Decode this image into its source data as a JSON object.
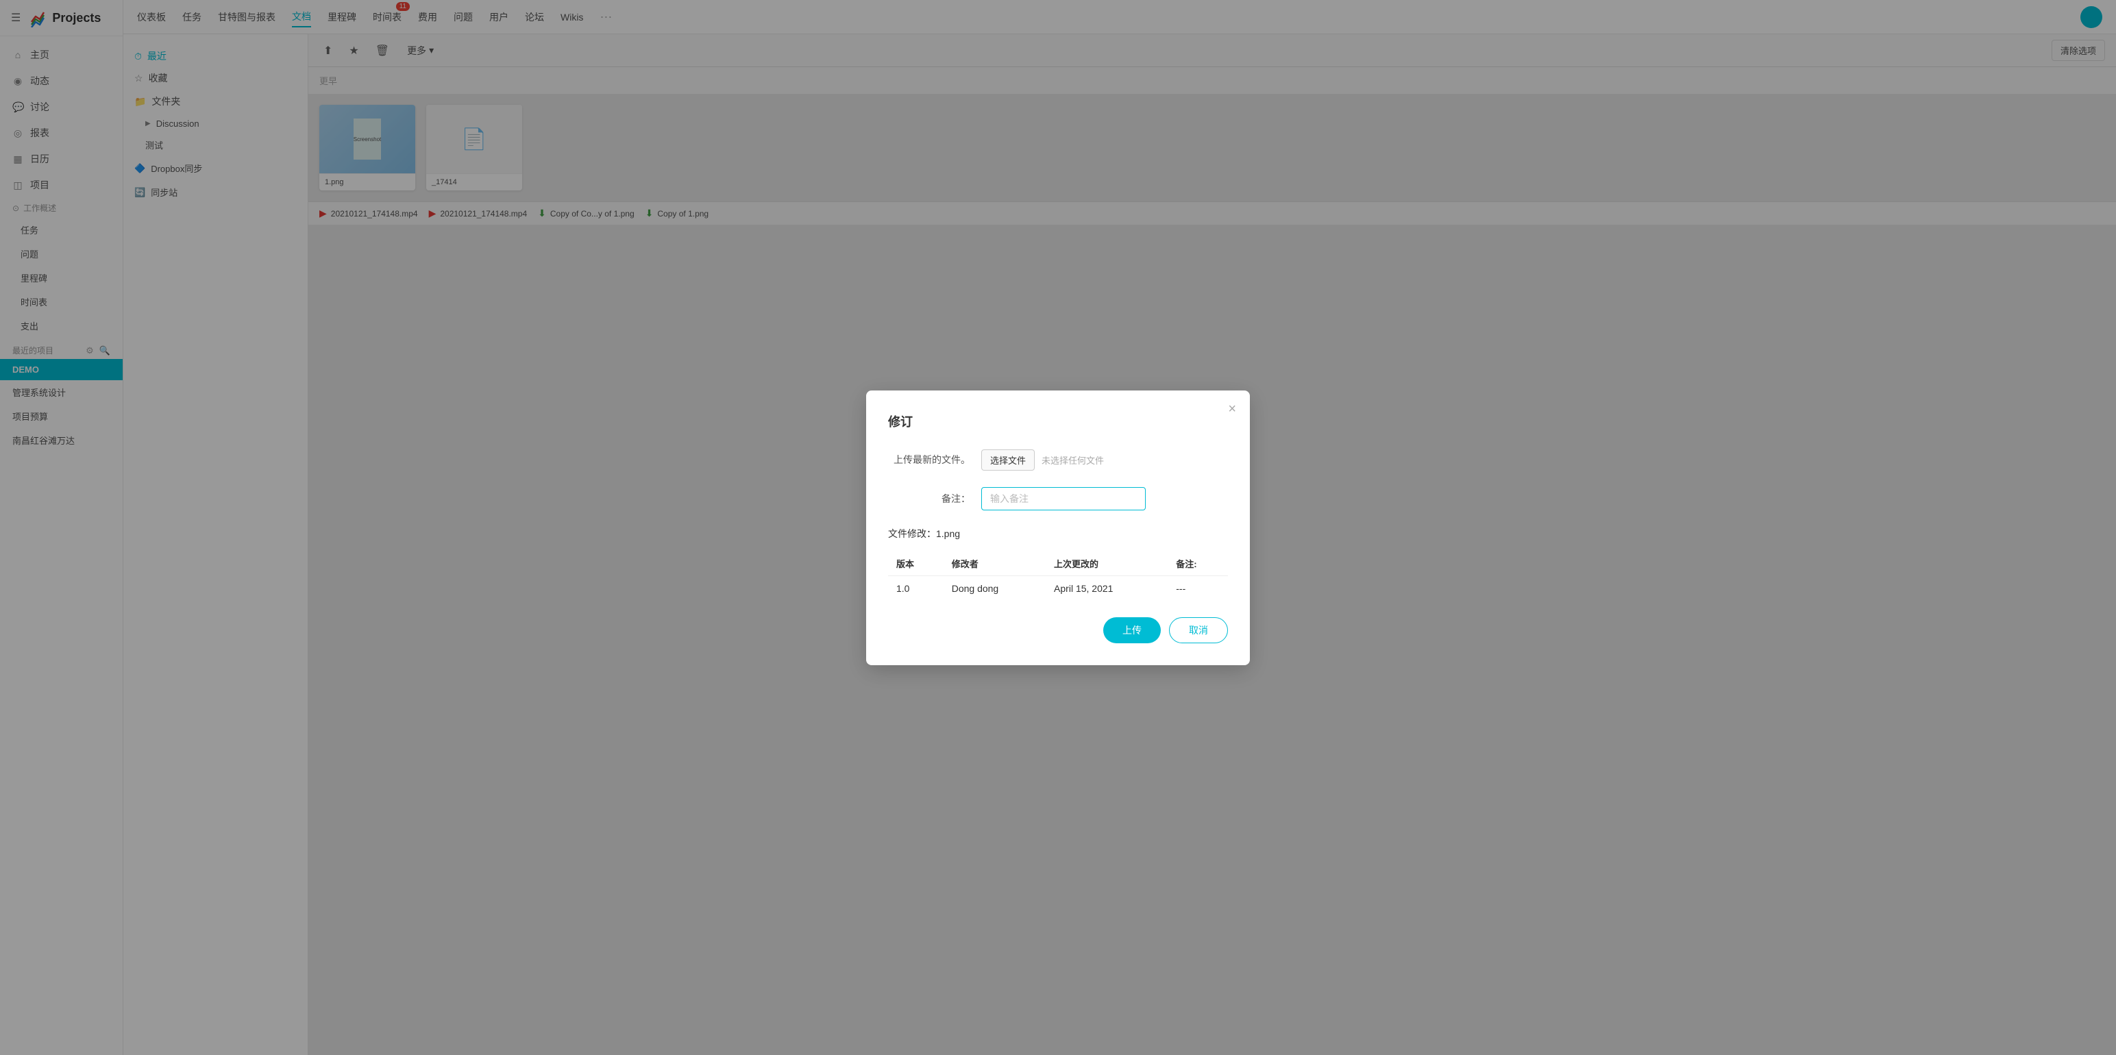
{
  "app": {
    "title": "Projects",
    "hamburger": "☰"
  },
  "top_nav": {
    "items": [
      {
        "label": "仪表板",
        "active": false
      },
      {
        "label": "任务",
        "active": false
      },
      {
        "label": "甘特图与报表",
        "active": false
      },
      {
        "label": "文档",
        "active": true
      },
      {
        "label": "里程碑",
        "active": false
      },
      {
        "label": "时间表",
        "active": false,
        "badge": "11"
      },
      {
        "label": "费用",
        "active": false
      },
      {
        "label": "问题",
        "active": false
      },
      {
        "label": "用户",
        "active": false
      },
      {
        "label": "论坛",
        "active": false
      },
      {
        "label": "Wikis",
        "active": false
      }
    ],
    "more": "···"
  },
  "sidebar": {
    "nav_items": [
      {
        "icon": "⌂",
        "label": "主页"
      },
      {
        "icon": "◉",
        "label": "动态"
      },
      {
        "icon": "💬",
        "label": "讨论"
      },
      {
        "icon": "◎",
        "label": "报表"
      },
      {
        "icon": "▦",
        "label": "日历"
      },
      {
        "icon": "◫",
        "label": "项目"
      }
    ],
    "work_overview": {
      "label": "工作概述",
      "items": [
        "任务",
        "问题",
        "里程碑",
        "时间表",
        "支出"
      ]
    },
    "recent_projects": {
      "label": "最近的项目",
      "items": [
        {
          "label": "DEMO",
          "active": true
        },
        {
          "label": "管理系统设计",
          "active": false
        },
        {
          "label": "项目预算",
          "active": false
        },
        {
          "label": "南昌红谷滩万达",
          "active": false
        }
      ]
    }
  },
  "doc_left": {
    "sections": [
      {
        "icon": "⏱",
        "label": "最近",
        "active": true
      },
      {
        "icon": "☆",
        "label": "收藏",
        "active": false
      }
    ],
    "folder_label": "文件夹",
    "folders": [
      {
        "label": "Discussion",
        "arrow": "▶"
      },
      {
        "label": "测试",
        "indent": true
      }
    ],
    "dropbox_label": "Dropbox同步",
    "sync_label": "同步站"
  },
  "toolbar": {
    "share_icon": "⬆",
    "star_icon": "★",
    "delete_icon": "🗑",
    "more_label": "更多",
    "more_icon": "▾",
    "clear_label": "清除选项"
  },
  "section_label": "更早",
  "file_bar": {
    "items": [
      {
        "icon": "▶",
        "icon_color": "red",
        "name": "20210121_174148.mp4"
      },
      {
        "icon": "▶",
        "icon_color": "red",
        "name": "20210121_174148.mp4"
      },
      {
        "icon": "⬇",
        "icon_color": "green",
        "name": "Copy of Co...y of 1.png"
      },
      {
        "icon": "⬇",
        "icon_color": "green",
        "name": "Copy of 1.png"
      }
    ]
  },
  "modal": {
    "title": "修订",
    "close_icon": "×",
    "upload_label": "上传最新的文件。",
    "choose_file_btn": "选择文件",
    "no_file_text": "未选择任何文件",
    "note_label": "备注：",
    "note_placeholder": "输入备注",
    "file_info": "文件修改：1.png",
    "table": {
      "headers": [
        "版本",
        "修改者",
        "上次更改的",
        "备注:"
      ],
      "rows": [
        {
          "version": "1.0",
          "modifier": "Dong dong",
          "date": "April 15, 2021",
          "note": "---"
        }
      ]
    },
    "upload_btn": "上传",
    "cancel_btn": "取消"
  }
}
